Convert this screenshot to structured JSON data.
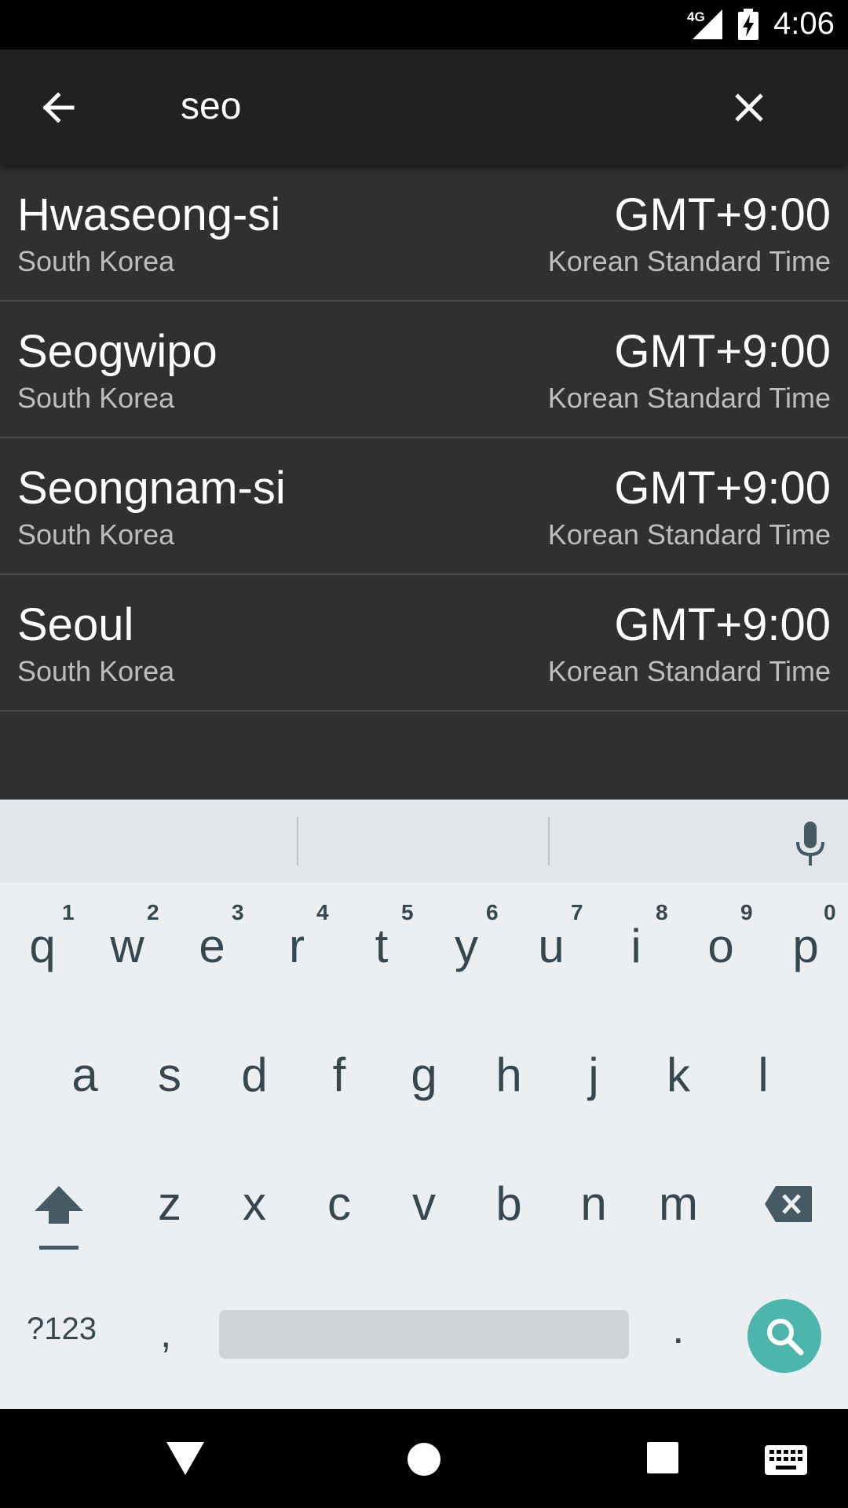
{
  "status_bar": {
    "network": "4G",
    "time": "4:06"
  },
  "toolbar": {
    "query": "seo"
  },
  "results": [
    {
      "city": "Hwaseong-si",
      "country": "South Korea",
      "offset": "GMT+9:00",
      "tz_name": "Korean Standard Time"
    },
    {
      "city": "Seogwipo",
      "country": "South Korea",
      "offset": "GMT+9:00",
      "tz_name": "Korean Standard Time"
    },
    {
      "city": "Seongnam-si",
      "country": "South Korea",
      "offset": "GMT+9:00",
      "tz_name": "Korean Standard Time"
    },
    {
      "city": "Seoul",
      "country": "South Korea",
      "offset": "GMT+9:00",
      "tz_name": "Korean Standard Time"
    }
  ],
  "keyboard": {
    "row1": [
      "q",
      "w",
      "e",
      "r",
      "t",
      "y",
      "u",
      "i",
      "o",
      "p"
    ],
    "row1_hints": [
      "1",
      "2",
      "3",
      "4",
      "5",
      "6",
      "7",
      "8",
      "9",
      "0"
    ],
    "row2": [
      "a",
      "s",
      "d",
      "f",
      "g",
      "h",
      "j",
      "k",
      "l"
    ],
    "row3": [
      "z",
      "x",
      "c",
      "v",
      "b",
      "n",
      "m"
    ],
    "symbols_label": "?123",
    "comma": ",",
    "period": "."
  },
  "colors": {
    "toolbar": "#212121",
    "list_bg": "#303030",
    "keyboard_bg": "#eceff1",
    "search_key": "#4db6ac"
  }
}
